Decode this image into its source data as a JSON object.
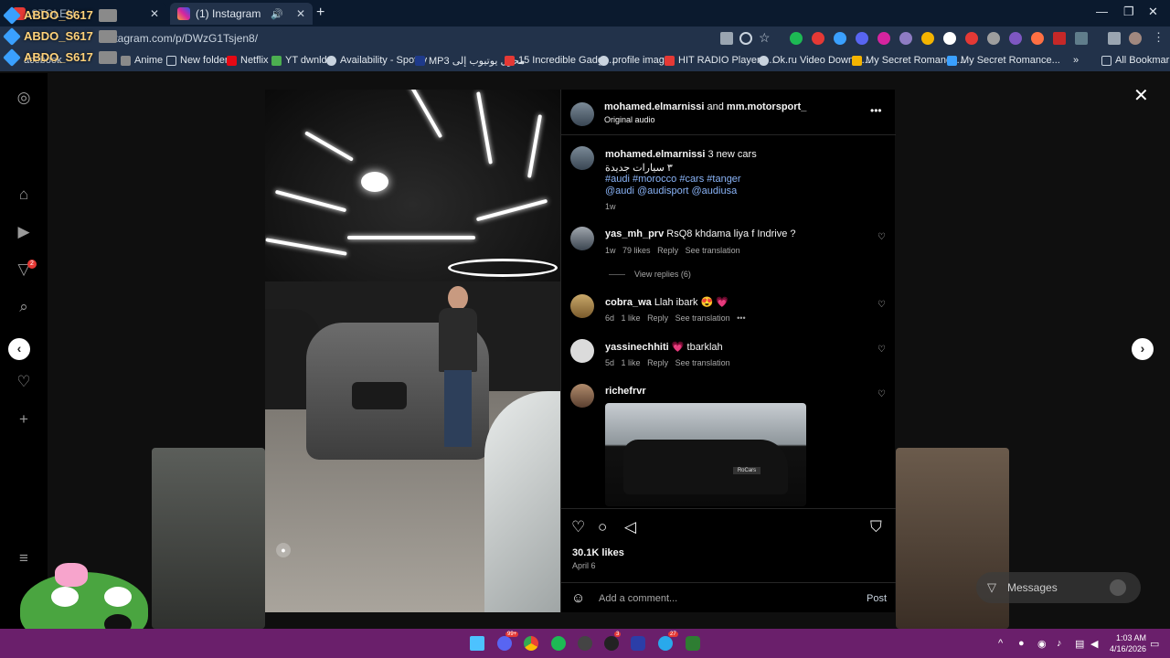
{
  "browser": {
    "tabs": [
      {
        "label": "ABDO_S617",
        "secondary": "STOLEN"
      },
      {
        "label": "(1) Instagram"
      }
    ],
    "url": "instagram.com/p/DWzG1Tsjen8/",
    "overlay_names": [
      "ABDO_S617",
      "ABDO_S617",
      "ABDO_S617"
    ],
    "bookmarks": [
      "acebook",
      "Anime",
      "New folder",
      "Netflix",
      "YT dwnld",
      "Availability - Spotify",
      "MP3 محول يوتيوب إلى",
      "15 Incredible Gadge...",
      "profile image",
      "HIT RADIO Player -...",
      "Ok.ru Video Downlo...",
      "My Secret Romance...",
      "My Secret Romance..."
    ],
    "all_bookmarks": "All Bookmarks",
    "colors": {
      "chrome": "#22324a",
      "tabbar": "#0b1a2e"
    }
  },
  "post": {
    "header": {
      "author": "mohamed.elmarnissi",
      "and": "and",
      "coauthor": "mm.motorsport_",
      "audio": "Original audio",
      "more": "•••"
    },
    "caption": {
      "author": "mohamed.elmarnissi",
      "text": "3 new cars",
      "arabic": "٣ سيارات جديدة",
      "hashtags": "#audi #morocco #cars #tanger",
      "mentions": "@audi @audisport @audiusa",
      "time": "1w"
    },
    "comments": [
      {
        "user": "yas_mh_prv",
        "text": "RsQ8 khdama liya f Indrive ?",
        "time": "1w",
        "likes": "79 likes",
        "reply": "Reply",
        "translate": "See translation",
        "view_replies": "View replies (6)"
      },
      {
        "user": "cobra_wa",
        "text": "Llah ibark 😍 💗",
        "time": "6d",
        "likes": "1 like",
        "reply": "Reply",
        "translate": "See translation",
        "more": "•••"
      },
      {
        "user": "yassinechhiti",
        "text": "💗 tbarklah",
        "time": "5d",
        "likes": "1 like",
        "reply": "Reply",
        "translate": "See translation"
      },
      {
        "user": "richefrvr",
        "image_label": "RoCars"
      }
    ],
    "likes": "30.1K likes",
    "date": "April 6",
    "comment_placeholder": "Add a comment...",
    "post_button": "Post"
  },
  "messages": {
    "label": "Messages"
  },
  "sidebar": {
    "badge": "2"
  },
  "taskbar": {
    "time": "1:03 AM",
    "date": "4/16/2026",
    "badges": [
      "99+",
      "3",
      "27"
    ]
  }
}
